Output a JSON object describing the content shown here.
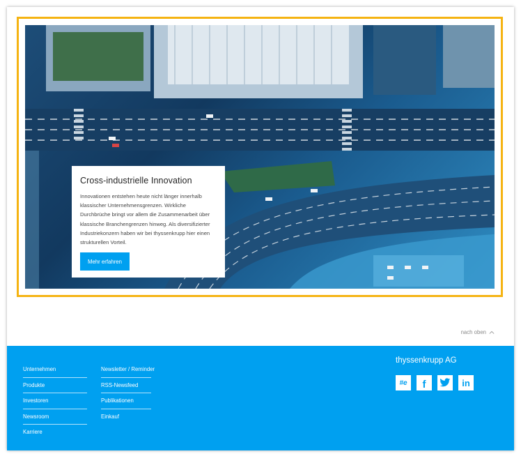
{
  "hero": {
    "title": "Cross-industrielle Innovation",
    "body": "Innovationen entstehen heute nicht länger innerhalb klassischer Unternehmensgrenzen. Wirkliche Durchbrüche bringt vor allem die Zusammenarbeit über klassische Branchengrenzen hinweg. Als diversifizierter Industriekonzern haben wir bei thyssenkrupp hier einen strukturellen Vorteil.",
    "cta_label": "Mehr erfahren"
  },
  "back_to_top": "nach oben",
  "footer": {
    "col1": [
      "Unternehmen",
      "Produkte",
      "Investoren",
      "Newsroom",
      "Karriere"
    ],
    "col2": [
      "Newsletter / Reminder",
      "RSS-Newsfeed",
      "Publikationen",
      "Einkauf"
    ],
    "brand": "thyssenkrupp AG",
    "social": {
      "hashtag": "#e",
      "facebook": "f",
      "twitter_icon": "twitter-icon",
      "linkedin": "in"
    }
  },
  "colors": {
    "accent": "#00a0f0",
    "highlight": "#f5b312"
  }
}
